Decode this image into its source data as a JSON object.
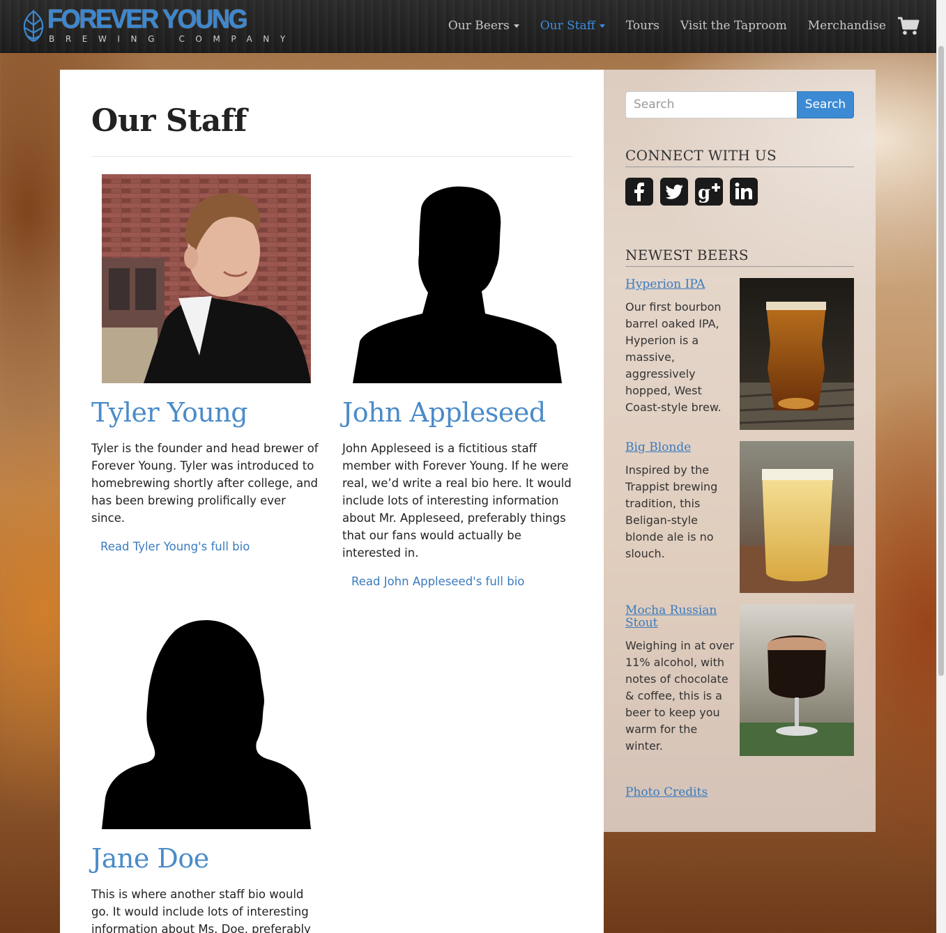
{
  "brand": {
    "title": "FOREVER YOUNG",
    "subtitle": "BREWING COMPANY",
    "color": "#3c87cf"
  },
  "nav": {
    "items": [
      {
        "label": "Our Beers",
        "dropdown": true,
        "active": false
      },
      {
        "label": "Our Staff",
        "dropdown": true,
        "active": true
      },
      {
        "label": "Tours",
        "dropdown": false,
        "active": false
      },
      {
        "label": "Visit the Taproom",
        "dropdown": false,
        "active": false
      },
      {
        "label": "Merchandise",
        "dropdown": false,
        "active": false
      }
    ],
    "cart_icon": "shopping-cart-icon",
    "active_color": "#3a8ee0"
  },
  "page": {
    "title": "Our Staff"
  },
  "staff": [
    {
      "name": "Tyler Young",
      "bio": "Tyler is the founder and head brewer of Forever Young. Tyler was introduced to homebrewing shortly after college, and has been brewing prolifically ever since.",
      "link": "Read Tyler Young's full bio",
      "photo": "portrait-photo"
    },
    {
      "name": "John Appleseed",
      "bio": "John Appleseed is a fictitious staff member with Forever Young. If he were real, we’d write a real bio here. It would include lots of interesting information about Mr. Appleseed, preferably things that our fans would actually be interested in.",
      "link": "Read John Appleseed's full bio",
      "photo": "male-silhouette"
    },
    {
      "name": "Jane Doe",
      "bio": "This is where another staff bio would go. It would include lots of interesting information about Ms. Doe, preferably",
      "photo": "female-silhouette"
    }
  ],
  "sidebar": {
    "search_placeholder": "Search",
    "search_button": "Search",
    "connect_heading": "CONNECT WITH US",
    "social": [
      "facebook-icon",
      "twitter-icon",
      "google-plus-icon",
      "linkedin-icon"
    ],
    "newest_heading": "NEWEST BEERS",
    "beers": [
      {
        "name": "Hyperion IPA",
        "desc": "Our first bourbon barrel oaked IPA, Hyperion is a massive, aggressively hopped, West Coast-style brew.",
        "photo": "amber-beer-photo"
      },
      {
        "name": "Big Blonde",
        "desc": "Inspired by the Trappist brewing tradition, this Beligan-style blonde ale is no slouch.",
        "photo": "blonde-beer-photo"
      },
      {
        "name": "Mocha Russian Stout",
        "desc": "Weighing in at over 11% alcohol, with notes of chocolate & coffee, this is a beer to keep you warm for the winter.",
        "photo": "stout-beer-photo"
      }
    ],
    "photo_credits": "Photo Credits"
  }
}
